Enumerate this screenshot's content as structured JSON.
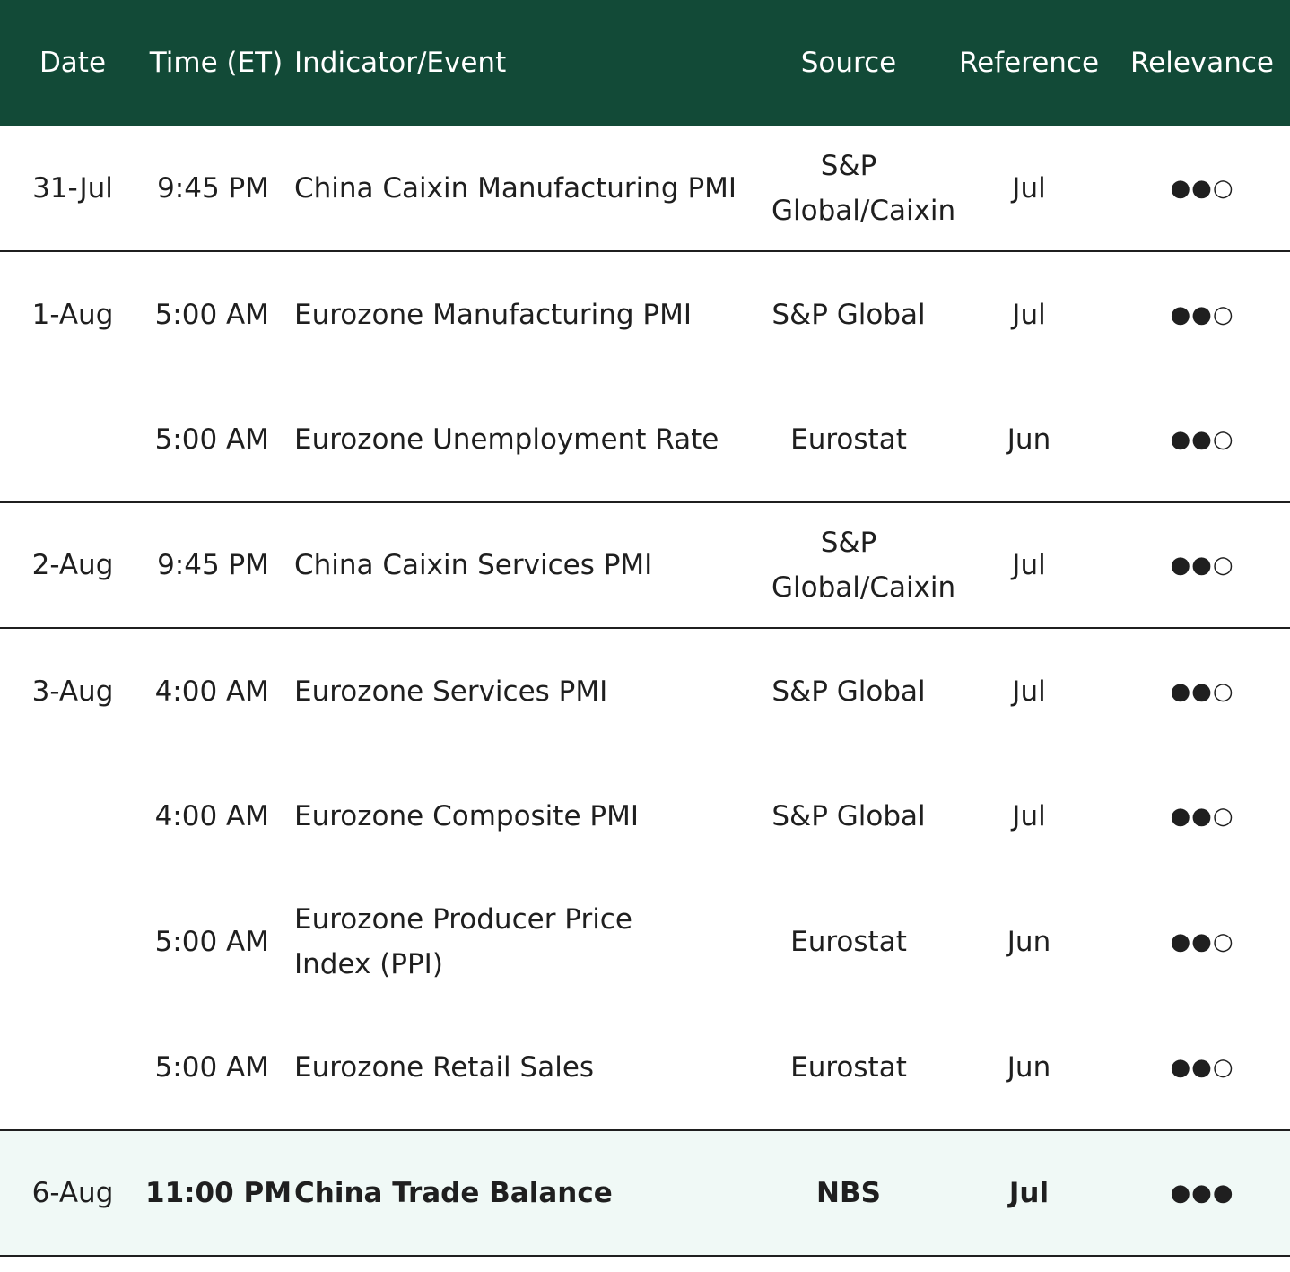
{
  "header": {
    "date": "Date",
    "time": "Time (ET)",
    "indicator": "Indicator/Event",
    "source": "Source",
    "reference": "Reference",
    "relevance": "Relevance"
  },
  "rows": [
    {
      "date": "31-Jul",
      "time": "9:45 PM",
      "indicator": "China Caixin Manufacturing PMI",
      "source": "S&P Global/Caixin",
      "reference": "Jul",
      "relevance": "●●○"
    },
    {
      "date": "1-Aug",
      "time": "5:00 AM",
      "indicator": "Eurozone Manufacturing PMI",
      "source": "S&P Global",
      "reference": "Jul",
      "relevance": "●●○"
    },
    {
      "date": "",
      "time": "5:00 AM",
      "indicator": "Eurozone Unemployment Rate",
      "source": "Eurostat",
      "reference": "Jun",
      "relevance": "●●○"
    },
    {
      "date": "2-Aug",
      "time": "9:45 PM",
      "indicator": "China Caixin Services PMI",
      "source": "S&P Global/Caixin",
      "reference": "Jul",
      "relevance": "●●○"
    },
    {
      "date": "3-Aug",
      "time": "4:00 AM",
      "indicator": "Eurozone Services PMI",
      "source": "S&P Global",
      "reference": "Jul",
      "relevance": "●●○"
    },
    {
      "date": "",
      "time": "4:00 AM",
      "indicator": "Eurozone Composite PMI",
      "source": "S&P Global",
      "reference": "Jul",
      "relevance": "●●○"
    },
    {
      "date": "",
      "time": "5:00 AM",
      "indicator": "Eurozone Producer Price Index (PPI)",
      "source": "Eurostat",
      "reference": "Jun",
      "relevance": "●●○"
    },
    {
      "date": "",
      "time": "5:00 AM",
      "indicator": "Eurozone Retail Sales",
      "source": "Eurostat",
      "reference": "Jun",
      "relevance": "●●○"
    },
    {
      "date": "6-Aug",
      "time": "11:00 PM",
      "indicator": "China Trade Balance",
      "source": "NBS",
      "reference": "Jul",
      "relevance": "●●●"
    }
  ],
  "colors": {
    "header_bg": "#124a37",
    "highlight_bg": "#f0f9f6",
    "text": "#1f1f1f"
  }
}
